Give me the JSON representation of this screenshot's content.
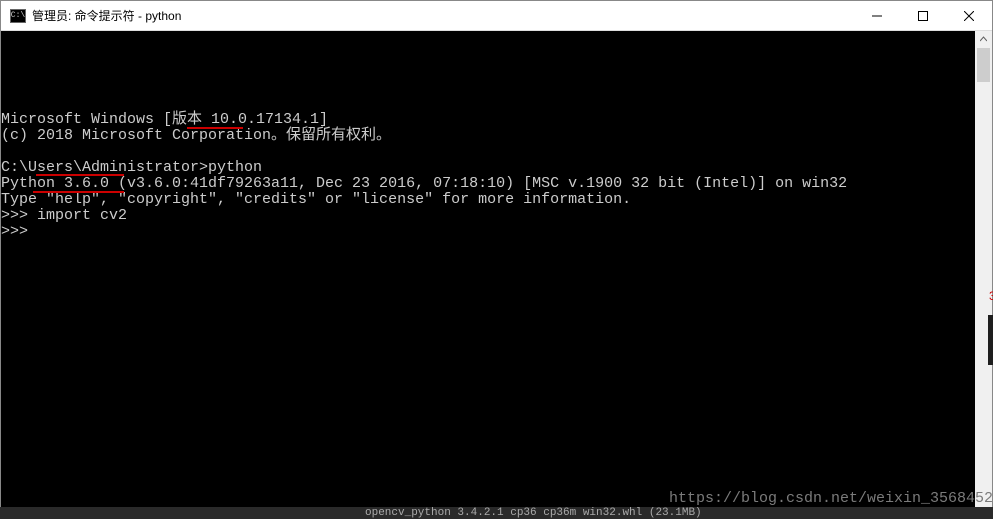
{
  "window": {
    "icon_text": "C:\\",
    "title": "管理员: 命令提示符 - python"
  },
  "controls": {
    "minimize": "minimize",
    "maximize": "maximize",
    "close": "close"
  },
  "console": {
    "lines": [
      "Microsoft Windows [版本 10.0.17134.1]",
      "(c) 2018 Microsoft Corporation。保留所有权利。",
      "",
      "C:\\Users\\Administrator>python",
      "Python 3.6.0 (v3.6.0:41df79263a11, Dec 23 2016, 07:18:10) [MSC v.1900 32 bit (Intel)] on win32",
      "Type \"help\", \"copyright\", \"credits\" or \"license\" for more information.",
      ">>> import cv2",
      ">>>"
    ]
  },
  "annotations": {
    "underline1_text": "python",
    "underline2_text": "import cv2",
    "underline3_text": ""
  },
  "watermark": "https://blog.csdn.net/weixin_3568452",
  "background_fragment": "opencv_python 3.4.2.1  cp36 cp36m win32.whl (23.1MB)"
}
